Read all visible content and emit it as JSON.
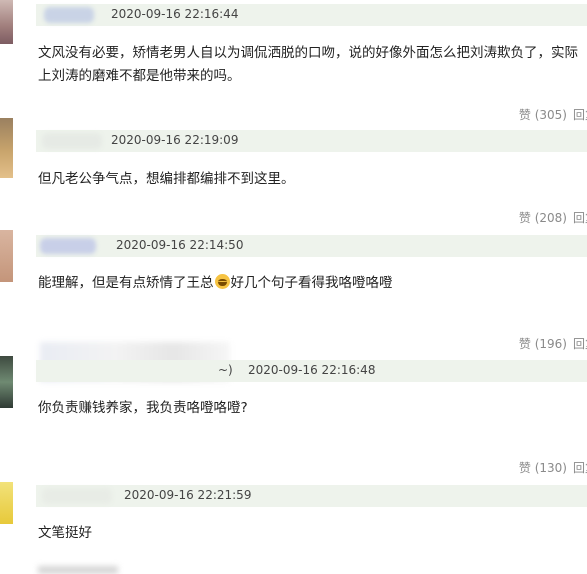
{
  "comments": [
    {
      "timestamp": "2020-09-16 22:16:44",
      "text_line1": "文风没有必要，矫情老男人自以为调侃洒脱的口吻，说的好像外面怎么把刘涛欺负了，实际",
      "text_line2": "上刘涛的磨难不都是他带来的吗。",
      "like_label": "赞 (305)",
      "reply_label": "回复"
    },
    {
      "timestamp": "2020-09-16 22:19:09",
      "text_line1": "但凡老公争气点，想编排都编排不到这里。",
      "like_label": "赞 (208)",
      "reply_label": "回复"
    },
    {
      "timestamp": "2020-09-16 22:14:50",
      "text_before_emoji": "能理解，但是有点矫情了王总",
      "emoji_icon": "laughing-tears-emoji",
      "text_after_emoji": "好几个句子看得我咯噔咯噔",
      "like_label": "赞 (196)",
      "reply_label": "回复"
    },
    {
      "username_tail": "~)",
      "timestamp": "2020-09-16 22:16:48",
      "text_line1": "你负责赚钱养家，我负责咯噔咯噔?",
      "like_label": "赞 (130)",
      "reply_label": "回复"
    },
    {
      "timestamp": "2020-09-16 22:21:59",
      "text_line1": "文笔挺好"
    }
  ]
}
